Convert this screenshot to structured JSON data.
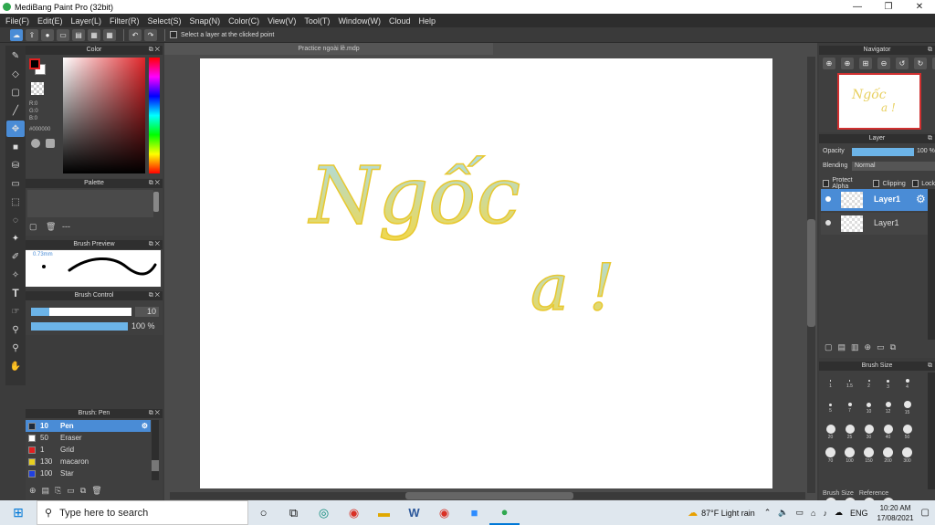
{
  "window": {
    "title": "MediBang Paint Pro (32bit)",
    "min": "—",
    "max": "❐",
    "close": "✕"
  },
  "menu": [
    "File(F)",
    "Edit(E)",
    "Layer(L)",
    "Filter(R)",
    "Select(S)",
    "Snap(N)",
    "Color(C)",
    "View(V)",
    "Tool(T)",
    "Window(W)",
    "Cloud",
    "Help"
  ],
  "toolbar": {
    "hint": "Select a layer at the clicked point"
  },
  "document": {
    "tab": "Practice ngoài lề.mdp",
    "artwork_text_1": "Ngốc",
    "artwork_text_2": "a !"
  },
  "color_panel": {
    "title": "Color",
    "r": "R:0",
    "g": "G:0",
    "b": "B:0",
    "hex": "#000000"
  },
  "palette_panel": {
    "title": "Palette",
    "dots": "---"
  },
  "brush_preview": {
    "title": "Brush Preview",
    "size": "0.73mm"
  },
  "brush_control": {
    "title": "Brush Control",
    "size_value": "10",
    "opacity_value": "100 %"
  },
  "brush_list": {
    "title": "Brush: Pen",
    "items": [
      {
        "size": "10",
        "name": "Pen",
        "color": "#1e2a3a"
      },
      {
        "size": "50",
        "name": "Eraser",
        "color": "#ffffff"
      },
      {
        "size": "1",
        "name": "Grid",
        "color": "#e02020"
      },
      {
        "size": "130",
        "name": "macaron",
        "color": "#e8d020"
      },
      {
        "size": "100",
        "name": "Star",
        "color": "#2040e0"
      }
    ]
  },
  "navigator": {
    "title": "Navigator"
  },
  "layer_panel": {
    "title": "Layer",
    "opacity_label": "Opacity",
    "opacity_value": "100 %",
    "blending_label": "Blending",
    "blending_value": "Normal",
    "protect_alpha": "Protect Alpha",
    "clipping": "Clipping",
    "lock": "Lock",
    "layers": [
      "Layer1",
      "Layer1"
    ]
  },
  "brush_size_panel": {
    "title": "Brush Size",
    "labels": [
      "1",
      "1.5",
      "2",
      "3",
      "4",
      "5",
      "7",
      "10",
      "12",
      "15",
      "20",
      "25",
      "30",
      "40",
      "50",
      "70",
      "100",
      "150",
      "200",
      "300"
    ],
    "tab_brush_size": "Brush Size",
    "tab_reference": "Reference"
  },
  "taskbar": {
    "search_placeholder": "Type here to search",
    "weather": "87°F  Light rain",
    "lang": "ENG",
    "time": "10:20 AM",
    "date": "17/08/2021"
  },
  "colors": {
    "accent": "#4a8cd6",
    "artwork_yellow": "#f2d84a",
    "artwork_blue": "#a8dcec"
  }
}
